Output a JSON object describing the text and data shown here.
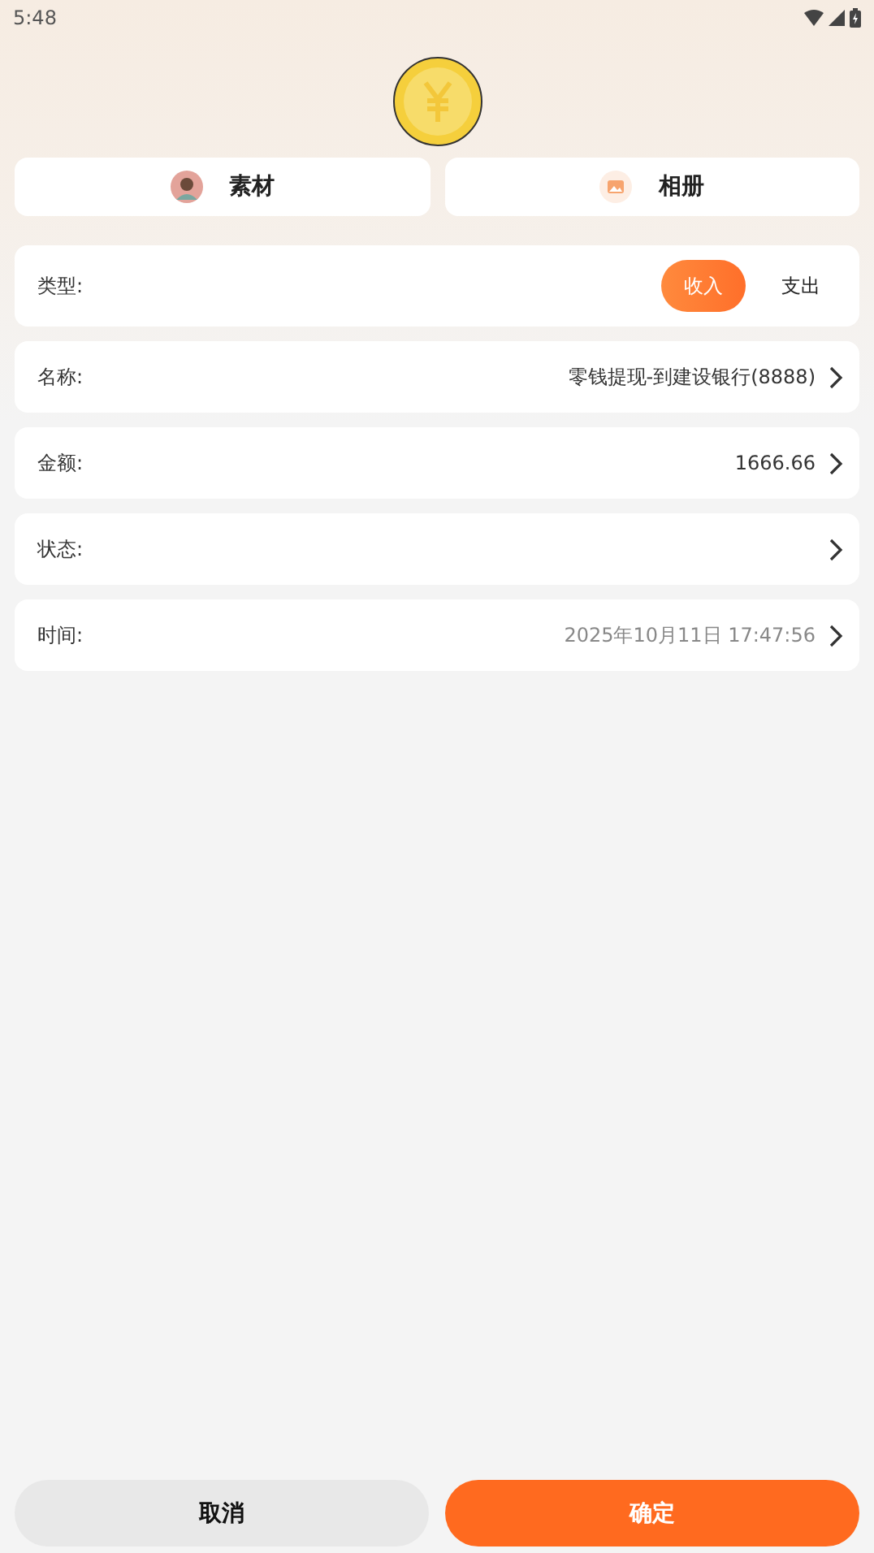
{
  "status_bar": {
    "time": "5:48"
  },
  "sources": [
    {
      "label": "素材",
      "kind": "avatar"
    },
    {
      "label": "相册",
      "kind": "photo"
    }
  ],
  "type_row": {
    "label": "类型:",
    "options": [
      {
        "label": "收入",
        "selected": true
      },
      {
        "label": "支出",
        "selected": false
      }
    ]
  },
  "fields": [
    {
      "label": "名称:",
      "value": "零钱提现-到建设银行(8888)",
      "kind": "text"
    },
    {
      "label": "金额:",
      "value": "1666.66",
      "kind": "text"
    },
    {
      "label": "状态:"
    },
    {
      "label": "时间:",
      "value": "2025年10月11日 17:47:56",
      "kind": "datetime"
    }
  ],
  "buttons": [
    {
      "label": "取消",
      "kind": "secondary"
    },
    {
      "label": "确定",
      "kind": "primary"
    }
  ]
}
